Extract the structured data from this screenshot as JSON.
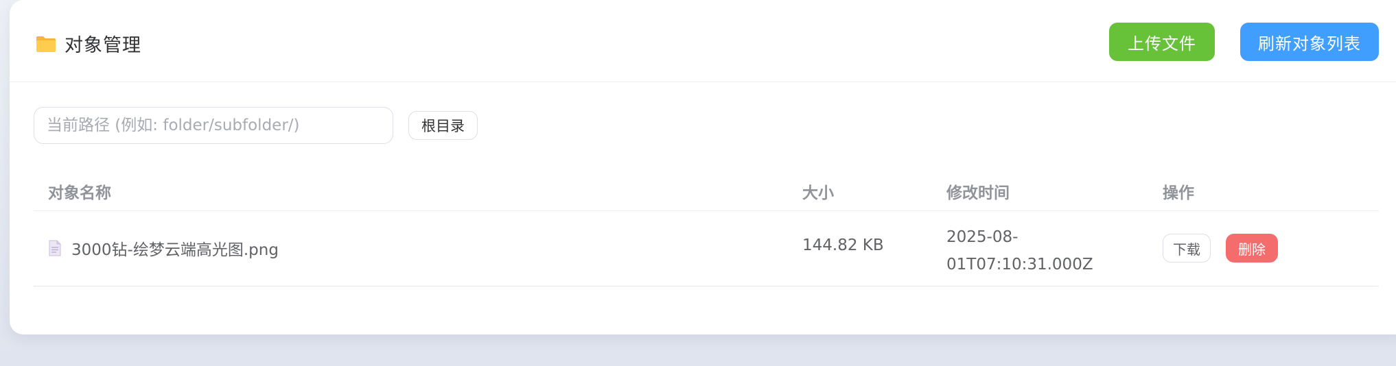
{
  "header": {
    "icon": "folder-icon",
    "title": "对象管理",
    "upload_label": "上传文件",
    "refresh_label": "刷新对象列表"
  },
  "path": {
    "placeholder": "当前路径 (例如: folder/subfolder/)",
    "value": "",
    "root_label": "根目录"
  },
  "table": {
    "columns": [
      "对象名称",
      "大小",
      "修改时间",
      "操作"
    ],
    "rows": [
      {
        "icon": "file-icon",
        "name": "3000钻-绘梦云端高光图.png",
        "size": "144.82 KB",
        "modified_line1": "2025-08-",
        "modified_line2": "01T07:10:31.000Z",
        "download_label": "下载",
        "delete_label": "删除"
      }
    ]
  },
  "colors": {
    "upload": "#67c23a",
    "refresh": "#409eff",
    "delete": "#f56c6c"
  }
}
